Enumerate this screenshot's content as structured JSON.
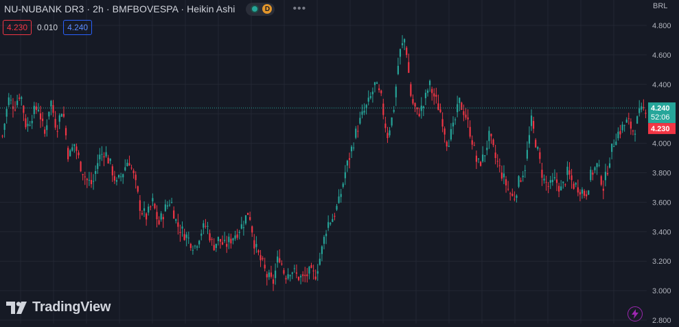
{
  "header": {
    "symbol_line": "NU-NUBANK DR3 · 2h · BMFBOVESPA · Heikin Ashi",
    "badge_letter": "D",
    "more": "•••"
  },
  "values": {
    "bid": "4.230",
    "spread": "0.010",
    "ask": "4.240"
  },
  "currency": "BRL",
  "brand": "TradingView",
  "colors": {
    "up": "#26a69a",
    "down": "#f23645",
    "background": "#161a25",
    "grid": "#232733",
    "last_price_line": "#26a69a"
  },
  "price_labels": {
    "last": "4.240",
    "countdown": "52:06",
    "bid": "4.230"
  },
  "chart_data": {
    "type": "candlestick",
    "style": "Heikin Ashi",
    "ylim": [
      2.8,
      4.85
    ],
    "y_ticks": [
      2.8,
      3.0,
      3.2,
      3.4,
      3.6,
      3.8,
      4.0,
      4.2,
      4.4,
      4.6,
      4.8
    ],
    "y_tick_labels": [
      "2.800",
      "3.000",
      "3.200",
      "3.400",
      "3.600",
      "3.800",
      "4.000",
      "4.200",
      "4.400",
      "4.600",
      "4.800"
    ],
    "grid": true,
    "last_price": 4.24,
    "candles": 305,
    "close_path": [
      4.05,
      4.3,
      4.25,
      4.35,
      4.1,
      4.2,
      4.25,
      4.05,
      4.3,
      4.1,
      4.25,
      3.9,
      4.0,
      3.85,
      3.75,
      3.72,
      3.9,
      3.95,
      3.85,
      3.72,
      3.8,
      3.9,
      3.75,
      3.55,
      3.5,
      3.6,
      3.45,
      3.55,
      3.62,
      3.45,
      3.4,
      3.35,
      3.3,
      3.4,
      3.45,
      3.3,
      3.35,
      3.3,
      3.35,
      3.4,
      3.45,
      3.55,
      3.3,
      3.2,
      3.1,
      3.05,
      3.25,
      3.1,
      3.15,
      3.1,
      3.08,
      3.12,
      3.1,
      3.25,
      3.45,
      3.5,
      3.6,
      3.8,
      3.95,
      4.1,
      4.2,
      4.28,
      4.4,
      4.3,
      4.05,
      4.2,
      4.6,
      4.72,
      4.3,
      4.2,
      4.25,
      4.4,
      4.3,
      4.2,
      4.0,
      4.1,
      4.28,
      4.2,
      4.05,
      3.85,
      3.9,
      4.05,
      3.9,
      3.8,
      3.7,
      3.62,
      3.75,
      3.85,
      4.15,
      3.95,
      3.75,
      3.7,
      3.75,
      3.68,
      3.8,
      3.72,
      3.7,
      3.65,
      3.8,
      3.85,
      3.7,
      3.9,
      4.05,
      4.1,
      4.15,
      4.08,
      4.2,
      4.24
    ]
  }
}
